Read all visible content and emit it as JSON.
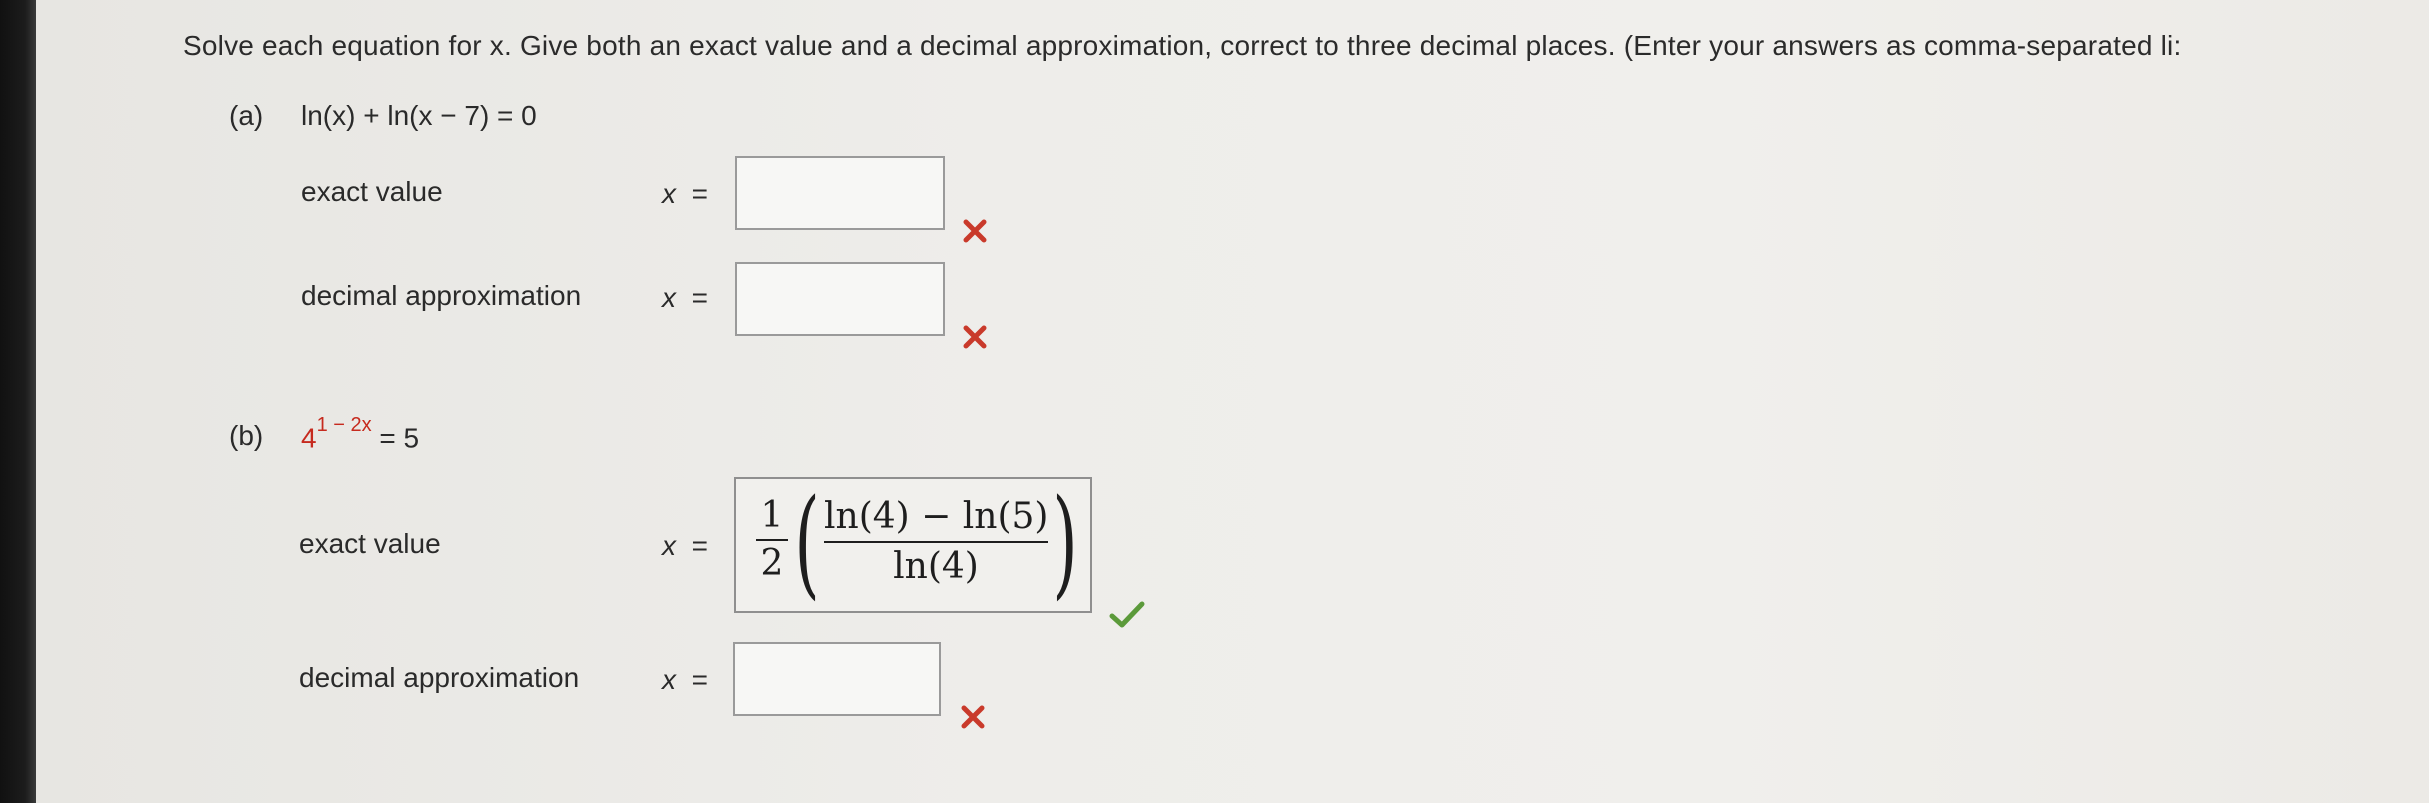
{
  "instructions": "Solve each equation for x. Give both an exact value and a decimal approximation, correct to three decimal places. (Enter your answers as comma-separated li:",
  "part_a": {
    "label": "(a)",
    "equation": "ln(x) + ln(x − 7) = 0",
    "exact": {
      "label": "exact value",
      "var": "x",
      "eq": "=",
      "value": "",
      "status": "incorrect"
    },
    "decimal": {
      "label": "decimal approximation",
      "var": "x",
      "eq": "=",
      "value": "",
      "status": "incorrect"
    }
  },
  "part_b": {
    "label": "(b)",
    "equation_base": "4",
    "equation_exponent": "1 − 2x",
    "equation_rhs": "= 5",
    "exact": {
      "label": "exact value",
      "var": "x",
      "eq": "=",
      "value_coef_num": "1",
      "value_coef_den": "2",
      "value_num": "ln(4) − ln(5)",
      "value_den": "ln(4)",
      "status": "correct"
    },
    "decimal": {
      "label": "decimal approximation",
      "var": "x",
      "eq": "=",
      "value": "",
      "status": "incorrect"
    }
  },
  "colors": {
    "incorrect_mark": "#c93a2b",
    "correct_mark": "#5b9a3a",
    "equation_red": "#c62a1e"
  },
  "icons": {
    "incorrect": "x-mark-icon",
    "correct": "check-mark-icon"
  }
}
